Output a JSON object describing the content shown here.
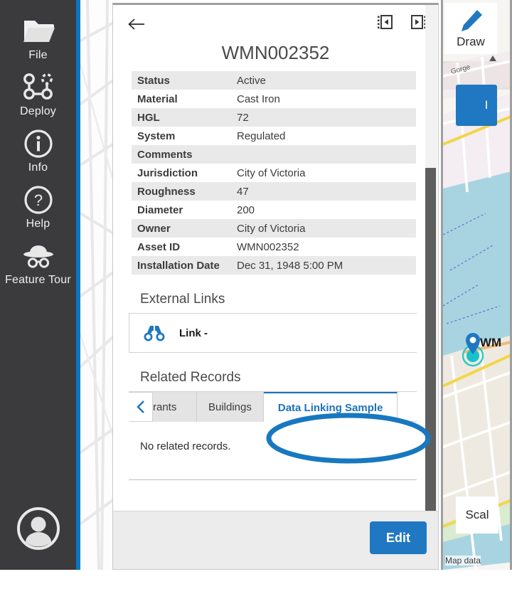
{
  "sidebar": {
    "items": [
      {
        "label": "File",
        "icon": "folder-icon"
      },
      {
        "label": "Deploy",
        "icon": "deploy-nodes-icon"
      },
      {
        "label": "Info",
        "icon": "info-circle-icon"
      },
      {
        "label": "Help",
        "icon": "question-circle-icon"
      },
      {
        "label": "Feature Tour",
        "icon": "explorer-hat-binoculars-icon"
      }
    ],
    "avatar_name": "user-avatar-icon"
  },
  "panel": {
    "back_icon": "back-arrow-icon",
    "dock_left_icon": "dock-panel-left-icon",
    "dock_right_icon": "dock-panel-right-icon",
    "record_title": "WMN002352",
    "attributes": [
      {
        "key": "Status",
        "value": "Active"
      },
      {
        "key": "Material",
        "value": "Cast Iron"
      },
      {
        "key": "HGL",
        "value": "72"
      },
      {
        "key": "System",
        "value": "Regulated"
      },
      {
        "key": "Comments",
        "value": ""
      },
      {
        "key": "Jurisdiction",
        "value": "City of Victoria"
      },
      {
        "key": "Roughness",
        "value": "47"
      },
      {
        "key": "Diameter",
        "value": "200"
      },
      {
        "key": "Owner",
        "value": "City of Victoria"
      },
      {
        "key": "Asset ID",
        "value": "WMN002352"
      },
      {
        "key": "Installation Date",
        "value": "Dec 31, 1948 5:00 PM"
      }
    ],
    "external_links": {
      "title": "External Links",
      "items": [
        {
          "icon": "binoculars-icon",
          "label": "Link -"
        }
      ]
    },
    "related_records": {
      "title": "Related Records",
      "prev_icon": "chevron-left-icon",
      "tabs": [
        {
          "label": "rants",
          "active": false
        },
        {
          "label": "Buildings",
          "active": false
        },
        {
          "label": "Data Linking Sample",
          "active": true
        }
      ],
      "empty_message": "No related records."
    },
    "footer": {
      "edit_label": "Edit"
    }
  },
  "map": {
    "draw_label": "Draw",
    "draw_icon": "pencil-icon",
    "popup_label": "I",
    "street_label": "Gorge",
    "marker_label": "WM",
    "marker_icon": "map-pin-icon",
    "scale_label": "Scal",
    "attribution": "Map data"
  },
  "annotation": {
    "type": "ellipse-highlight",
    "color": "#1878bf",
    "target": "Data Linking Sample"
  },
  "colors": {
    "accent_blue": "#0b76c2",
    "button_blue": "#1f78c1",
    "sidebar_dark": "#3b3b3d",
    "annotation_blue": "#1878bf",
    "row_shade": "#e9e9e9"
  }
}
